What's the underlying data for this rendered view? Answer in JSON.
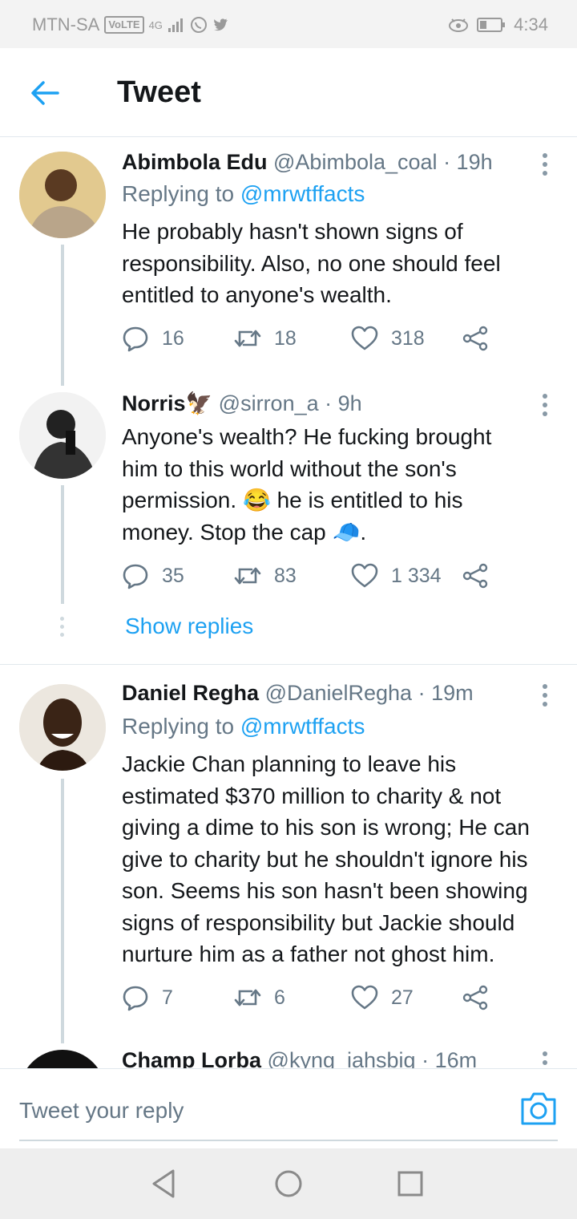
{
  "status_bar": {
    "carrier": "MTN-SA",
    "volte": "VoLTE",
    "network": "4G",
    "time": "4:34"
  },
  "header": {
    "title": "Tweet"
  },
  "tweets": [
    {
      "name": "Abimbola Edu",
      "handle": "@Abimbola_coal",
      "time": "· 19h",
      "replying_prefix": "Replying to",
      "replying_handle": "@mrwtffacts",
      "lines": [
        "He probably hasn't shown signs of",
        "responsibility.  Also, no one should feel",
        "entitled to anyone's wealth."
      ],
      "replies": "16",
      "retweets": "18",
      "likes": "318"
    },
    {
      "name": "Norris",
      "name_emoji": "🦅",
      "handle": "@sirron_a",
      "time": "· 9h",
      "lines": [
        "Anyone's wealth? He fucking brought",
        "him to this world without the son's",
        "permission. 😂 he is entitled to his",
        "money. Stop the cap 🧢."
      ],
      "replies": "35",
      "retweets": "83",
      "likes": "1 334",
      "show_replies": "Show replies"
    },
    {
      "name": "Daniel Regha",
      "handle": "@DanielRegha",
      "time": "· 19m",
      "replying_prefix": "Replying to",
      "replying_handle": "@mrwtffacts",
      "lines": [
        "Jackie Chan planning to leave his",
        "estimated $370 million to charity & not",
        "giving a dime to his son is wrong; He can",
        "give to charity but he shouldn't ignore his",
        "son. Seems his son hasn't been showing",
        "signs of responsibility but Jackie should",
        "nurture him as a father not ghost him."
      ],
      "replies": "7",
      "retweets": "6",
      "likes": "27"
    },
    {
      "name": "Champ Lorba",
      "handle": "@kyng_iahsbig",
      "time": "· 16m"
    }
  ],
  "composer": {
    "placeholder": "Tweet your reply"
  },
  "colors": {
    "accent": "#1da1f2",
    "muted": "#657786",
    "text": "#14171a"
  }
}
